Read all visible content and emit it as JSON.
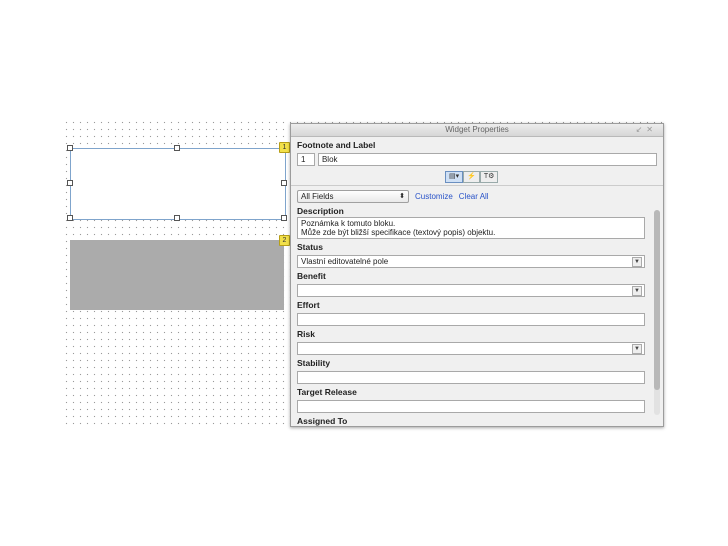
{
  "canvas": {
    "widget1": {
      "badge": "1"
    },
    "widget2": {
      "badge": "2"
    }
  },
  "panel": {
    "title": "Widget Properties",
    "window_controls": [
      "↙",
      "✕"
    ],
    "footnote_label": {
      "heading": "Footnote and Label",
      "number": "1",
      "label": "Blok"
    },
    "toolbar": {
      "buttons": [
        "▤▾",
        "⚡",
        "T⚙"
      ]
    },
    "filter": {
      "selected": "All Fields",
      "customize": "Customize",
      "clear_all": "Clear All"
    },
    "fields": {
      "description": {
        "label": "Description",
        "line1": "Poznámka k tomuto bloku.",
        "line2": "Může zde být bližší specifikace (textový popis) objektu."
      },
      "status": {
        "label": "Status",
        "value": "Vlastní editovatelné pole"
      },
      "benefit": {
        "label": "Benefit",
        "value": ""
      },
      "effort": {
        "label": "Effort",
        "value": ""
      },
      "risk": {
        "label": "Risk",
        "value": ""
      },
      "stability": {
        "label": "Stability",
        "value": ""
      },
      "target_release": {
        "label": "Target Release",
        "value": ""
      },
      "assigned_to": {
        "label": "Assigned To"
      }
    }
  }
}
